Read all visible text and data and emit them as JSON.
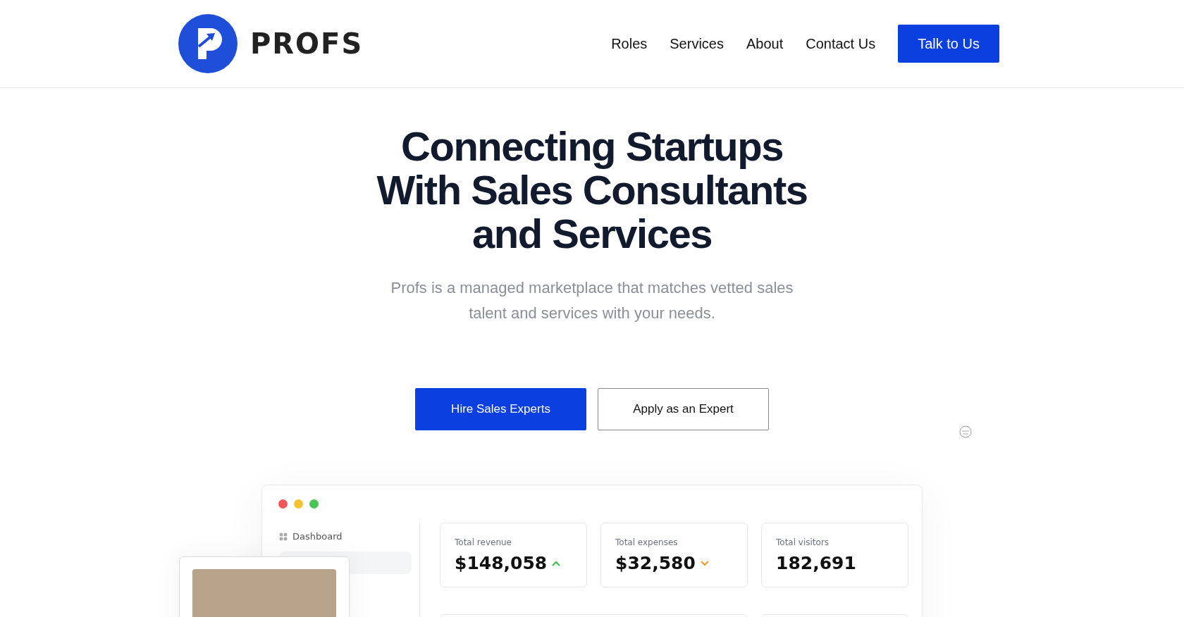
{
  "header": {
    "logo_text": "PROFS",
    "nav": [
      {
        "label": "Roles"
      },
      {
        "label": "Services"
      },
      {
        "label": "About"
      },
      {
        "label": "Contact Us"
      }
    ],
    "cta": "Talk to Us"
  },
  "hero": {
    "title_lines": [
      "Connecting Startups",
      "With Sales Consultants",
      "and Services"
    ],
    "subtitle": "Profs is a managed marketplace that matches vetted sales talent and services with your needs.",
    "buttons": [
      {
        "label": "Hire Sales Experts",
        "kind": "primary"
      },
      {
        "label": "Apply as an Expert",
        "kind": "outline"
      }
    ]
  },
  "dashboard": {
    "sidebar": [
      {
        "label": "Dashboard"
      }
    ],
    "stats": [
      {
        "label": "Total revenue",
        "value": "$148,058",
        "rising": true
      },
      {
        "label": "Total expenses",
        "value": "$32,580",
        "rising": false
      },
      {
        "label": "Total visitors",
        "value": "182,691"
      }
    ]
  }
}
